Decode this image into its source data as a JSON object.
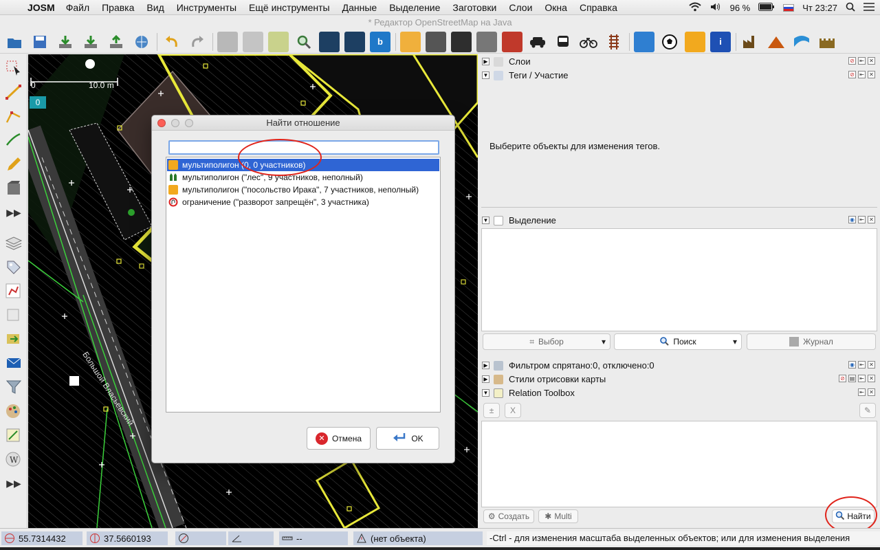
{
  "menubar": {
    "app_name": "JOSM",
    "items": [
      "Файл",
      "Правка",
      "Вид",
      "Инструменты",
      "Ещё инструменты",
      "Данные",
      "Выделение",
      "Заготовки",
      "Слои",
      "Окна",
      "Справка"
    ],
    "battery": "96 %",
    "clock": "Чт 23:27"
  },
  "window": {
    "title": "* Редактор OpenStreetMap на Java"
  },
  "toolbar": {
    "icons": [
      "open-icon",
      "save-icon",
      "download-icon",
      "download-data-icon",
      "upload-icon",
      "upload-changes-icon",
      "undo-icon",
      "redo-icon",
      "wms-icon",
      "zoom-icon",
      "imagery-icon",
      "bing-icon",
      "road-icon",
      "highway-icon",
      "car-icon",
      "bus-icon",
      "bicycle-icon",
      "railway-icon",
      "hotel-icon",
      "football-icon",
      "shop-icon",
      "information-icon",
      "industry-icon",
      "peak-icon",
      "water-icon",
      "castle-icon"
    ]
  },
  "map": {
    "scale_zero": "0",
    "scale_label": "10.0 m",
    "layer_badge": "0",
    "street_label": "Большой Власьевский"
  },
  "panels": {
    "layers": {
      "title": "Слои"
    },
    "tags": {
      "title": "Теги / Участие",
      "empty_message": "Выберите объекты для изменения тегов."
    },
    "selection": {
      "title": "Выделение",
      "btn_select": "Выбор",
      "btn_search": "Поиск",
      "btn_history": "Журнал"
    },
    "filter": {
      "title": "Фильтром спрятано:0, отключено:0"
    },
    "styles": {
      "title": "Стили отрисовки карты"
    },
    "relation_toolbox": {
      "title": "Relation Toolbox",
      "btn_clear": "X",
      "btn_create": "Создать",
      "btn_multi": "Multi",
      "btn_find": "Найти"
    }
  },
  "dialog": {
    "title": "Найти отношение",
    "search_value": "",
    "items": [
      "мультиполигон (0, 0 участников)",
      "мультиполигон (\"лес\", 9 участников, неполный)",
      "мультиполигон (\"посольство Ирака\", 7 участников, неполный)",
      "ограничение (\"разворот запрещён\", 3 участника)"
    ],
    "selected_index": 0,
    "btn_cancel": "Отмена",
    "btn_ok": "OK"
  },
  "statusbar": {
    "lat": "55.7314432",
    "lon": "37.5660193",
    "heading": "",
    "angle": "",
    "distance": "--",
    "object": "(нет объекта)",
    "help": "-Ctrl - для изменения масштаба выделенных объектов; или для изменения выделения"
  },
  "colors": {
    "selection_blue": "#2f65d4",
    "annotation_red": "#e0241b",
    "map_background": "#000000",
    "way_yellow": "#e8e83a",
    "way_green": "#3bd13b"
  }
}
